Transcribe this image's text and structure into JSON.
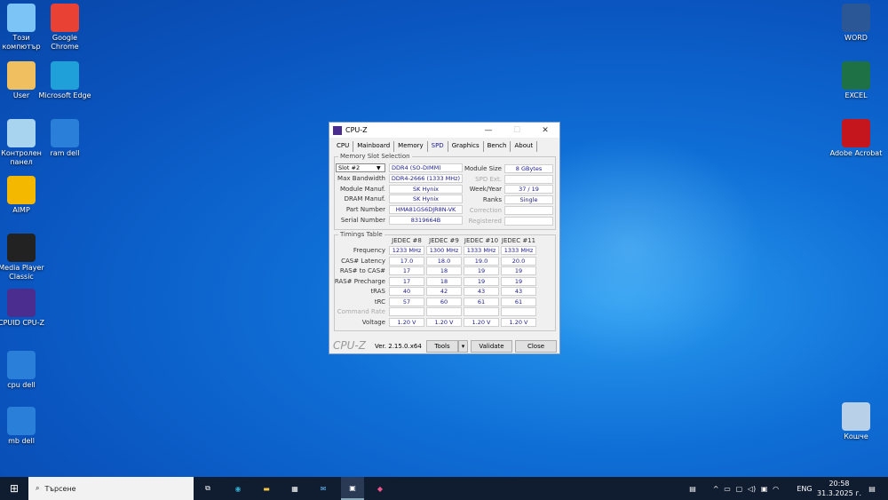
{
  "desktop": {
    "left": [
      {
        "label": "Този компютър",
        "color": "#7cc4f5"
      },
      {
        "label": "Google Chrome",
        "color": "#e94235"
      },
      {
        "label": "User",
        "color": "#f0c060"
      },
      {
        "label": "Microsoft Edge",
        "color": "#1fa0d8"
      },
      {
        "label": "Контролен панел",
        "color": "#a8d4f0"
      },
      {
        "label": "ram dell",
        "color": "#2a7fd8"
      },
      {
        "label": "AIMP",
        "color": "#f5b800"
      },
      {
        "label": "Media Player Classic",
        "color": "#222222"
      },
      {
        "label": "CPUID CPU-Z",
        "color": "#4b2d8f"
      },
      {
        "label": "cpu dell",
        "color": "#2a7fd8"
      },
      {
        "label": "mb dell",
        "color": "#2a7fd8"
      }
    ],
    "right": [
      {
        "label": "WORD",
        "color": "#2b5797"
      },
      {
        "label": "EXCEL",
        "color": "#1e7145"
      },
      {
        "label": "Adobe Acrobat",
        "color": "#c4161c"
      },
      {
        "label": "Кошче",
        "color": "#b8d0e8"
      }
    ]
  },
  "window": {
    "title": "CPU-Z",
    "tabs": [
      "CPU",
      "Mainboard",
      "Memory",
      "SPD",
      "Graphics",
      "Bench",
      "About"
    ],
    "active_tab": "SPD",
    "slot_group": "Memory Slot Selection",
    "slot": "Slot #2",
    "type": "DDR4 (SO-DIMM)",
    "fields": [
      {
        "label": "Max Bandwidth",
        "value": "DDR4-2666 (1333 MHz)"
      },
      {
        "label": "Module Manuf.",
        "value": "SK Hynix"
      },
      {
        "label": "DRAM Manuf.",
        "value": "SK Hynix"
      },
      {
        "label": "Part Number",
        "value": "HMA81GS6DJR8N-VK"
      },
      {
        "label": "Serial Number",
        "value": "8319664B"
      }
    ],
    "right_fields": [
      {
        "label": "Module Size",
        "value": "8 GBytes"
      },
      {
        "label": "SPD Ext.",
        "value": ""
      },
      {
        "label": "Week/Year",
        "value": "37 / 19"
      },
      {
        "label": "Ranks",
        "value": "Single"
      },
      {
        "label": "Correction",
        "value": ""
      },
      {
        "label": "Registered",
        "value": ""
      }
    ],
    "timings_group": "Timings Table",
    "columns": [
      "JEDEC #8",
      "JEDEC #9",
      "JEDEC #10",
      "JEDEC #11"
    ],
    "rows": [
      {
        "label": "Frequency",
        "values": [
          "1233 MHz",
          "1300 MHz",
          "1333 MHz",
          "1333 MHz"
        ]
      },
      {
        "label": "CAS# Latency",
        "values": [
          "17.0",
          "18.0",
          "19.0",
          "20.0"
        ]
      },
      {
        "label": "RAS# to CAS#",
        "values": [
          "17",
          "18",
          "19",
          "19"
        ]
      },
      {
        "label": "RAS# Precharge",
        "values": [
          "17",
          "18",
          "19",
          "19"
        ]
      },
      {
        "label": "tRAS",
        "values": [
          "40",
          "42",
          "43",
          "43"
        ]
      },
      {
        "label": "tRC",
        "values": [
          "57",
          "60",
          "61",
          "61"
        ]
      },
      {
        "label": "Command Rate",
        "values": [
          "",
          "",
          "",
          ""
        ]
      },
      {
        "label": "Voltage",
        "values": [
          "1.20 V",
          "1.20 V",
          "1.20 V",
          "1.20 V"
        ]
      }
    ],
    "brand": "CPU-Z",
    "version": "Ver. 2.15.0.x64",
    "tools": "Tools",
    "validate": "Validate",
    "close": "Close"
  },
  "taskbar": {
    "search_placeholder": "Търсене",
    "lang": "ENG",
    "time": "20:58",
    "date": "31.3.2025 г."
  }
}
